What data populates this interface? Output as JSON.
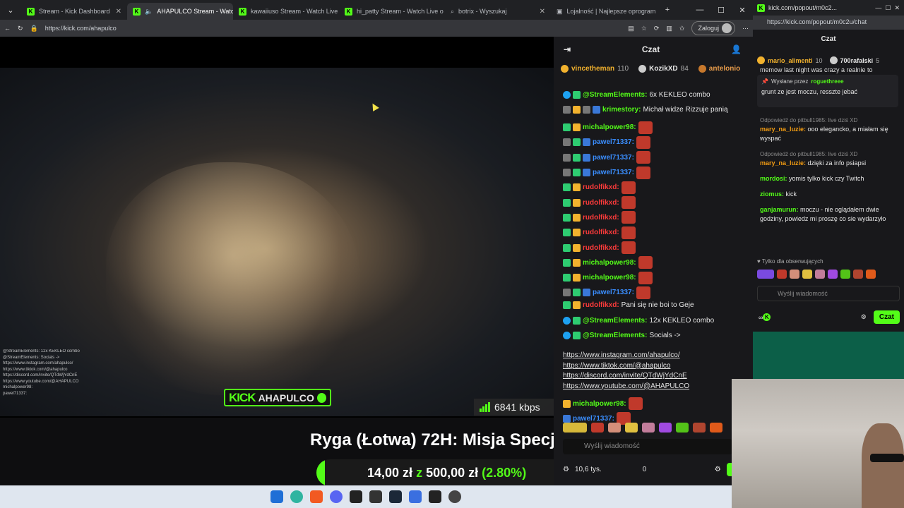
{
  "browser": {
    "tabs": [
      {
        "label": "Stream - Kick Dashboard",
        "active": false
      },
      {
        "label": "AHAPULCO Stream - Watch",
        "active": true
      },
      {
        "label": "kawaiiuso Stream - Watch Live o",
        "active": false
      },
      {
        "label": "hi_patty Stream - Watch Live o",
        "active": false
      },
      {
        "label": "botrix - Wyszukaj",
        "active": false
      },
      {
        "label": "Lojalność | Najlepsze oprogram",
        "active": false
      }
    ],
    "url": "https://kick.com/ahapulco",
    "login_label": "Zaloguj"
  },
  "video": {
    "overlay_chat": [
      "@StreamElements: 12x KEKLEO combo",
      "@StreamElements: Socials ->",
      "https://www.instagram.com/ahapulco/",
      "https://www.tiktok.com/@ahapulco",
      "https://discord.com/invite/QTdWjYdCnE",
      "https://www.youtube.com/@AHAPULCO",
      "michalpower98:",
      "pawel71337:"
    ],
    "logo_kick": "KICK",
    "logo_name": "AHAPULCO",
    "bitrate": "6841 kbps"
  },
  "goal": {
    "title": "Ryga (Łotwa) 72H: Misja Specjalna",
    "current": "14,00 zł",
    "connector": "z",
    "target": "500,00 zł",
    "percent_label": "(2.80%)",
    "progress": 0.028
  },
  "chat": {
    "title": "Czat",
    "pinned": [
      {
        "name": "vincetheman",
        "count": "110"
      },
      {
        "name": "KozikXD",
        "count": "84"
      },
      {
        "name": "antelonio",
        "count": ""
      }
    ],
    "messages": [
      {
        "user": "@StreamElements",
        "color": "#53fc18",
        "text": " 6x KEKLEO combo"
      },
      {
        "user": "krimestory",
        "color": "#53fc18",
        "text": " Michał widze Rizzuje panią"
      },
      {
        "user": "michalpower98",
        "color": "#53fc18",
        "text": ""
      },
      {
        "user": "pawel71337",
        "color": "#3a8eff",
        "text": ""
      },
      {
        "user": "pawel71337",
        "color": "#3a8eff",
        "text": ""
      },
      {
        "user": "pawel71337",
        "color": "#3a8eff",
        "text": ""
      },
      {
        "user": "rudolfikxd",
        "color": "#ff3b3b",
        "text": ""
      },
      {
        "user": "rudolfikxd",
        "color": "#ff3b3b",
        "text": ""
      },
      {
        "user": "rudolfikxd",
        "color": "#ff3b3b",
        "text": ""
      },
      {
        "user": "rudolfikxd",
        "color": "#ff3b3b",
        "text": ""
      },
      {
        "user": "rudolfikxd",
        "color": "#ff3b3b",
        "text": ""
      },
      {
        "user": "michalpower98",
        "color": "#53fc18",
        "text": ""
      },
      {
        "user": "michalpower98",
        "color": "#53fc18",
        "text": ""
      },
      {
        "user": "pawel71337",
        "color": "#3a8eff",
        "text": ""
      },
      {
        "user": "rudolfikxd",
        "color": "#ff3b3b",
        "text": " Pani się nie boi to Geje"
      },
      {
        "user": "@StreamElements",
        "color": "#53fc18",
        "text": " 12x KEKLEO combo"
      },
      {
        "user": "@StreamElements",
        "color": "#53fc18",
        "text": " Socials ->"
      }
    ],
    "links": [
      "https://www.instagram.com/ahapulco/",
      "https://www.tiktok.com/@ahapulco",
      "https://discord.com/invite/QTdWjYdCnE",
      "https://www.youtube.com/@AHAPULCO"
    ],
    "tail_messages": [
      {
        "user": "michalpower98",
        "color": "#53fc18"
      },
      {
        "user": "pawel71337",
        "color": "#3a8eff"
      }
    ],
    "input_placeholder": "Wyślij wiadomość",
    "points": "10,6 tys.",
    "zero": "0",
    "send_label": "Cz"
  },
  "popout": {
    "tab_title": "kick.com/popout/m0c2...",
    "url": "https://kick.com/popout/m0c2u/chat",
    "title": "Czat",
    "pinned": [
      {
        "name": "mario_alimenti",
        "count": "10"
      },
      {
        "name": "700rafalski",
        "count": "5"
      }
    ],
    "pinned_preview": "memow last night was crazy a realnie to",
    "pin_by_label": "Wysłane przez",
    "pin_by_user": "roguethreee",
    "pin_text": "grunt ze jest moczu, resszte jebać",
    "messages": [
      {
        "reply": "Odpowiedź do pitbull1985: live dziś XD",
        "user": "mary_na_luzie",
        "color": "#f39c12",
        "text": " ooo elegancko, a miałam się wyspać"
      },
      {
        "reply": "Odpowiedź do pitbull1985: live dziś XD",
        "user": "mary_na_luzie",
        "color": "#f39c12",
        "text": " dzięki za info psiapsi"
      },
      {
        "reply": "",
        "user": "mordosi",
        "color": "#53fc18",
        "text": " yomis tylko kick czy Twitch"
      },
      {
        "reply": "",
        "user": "ziomus",
        "color": "#53fc18",
        "text": " kick"
      },
      {
        "reply": "",
        "user": "ganjamurun",
        "color": "#53fc18",
        "text": " moczu - nie oglądałem dwie godziny, powiedz mi proszę co sie wydarzyło"
      }
    ],
    "followers_only": "Tylko dla obserwujących",
    "input_placeholder": "Wyślij wiadomość",
    "send_label": "Czat"
  },
  "colors": {
    "kick_green": "#53fc18",
    "bg": "#18181b"
  }
}
